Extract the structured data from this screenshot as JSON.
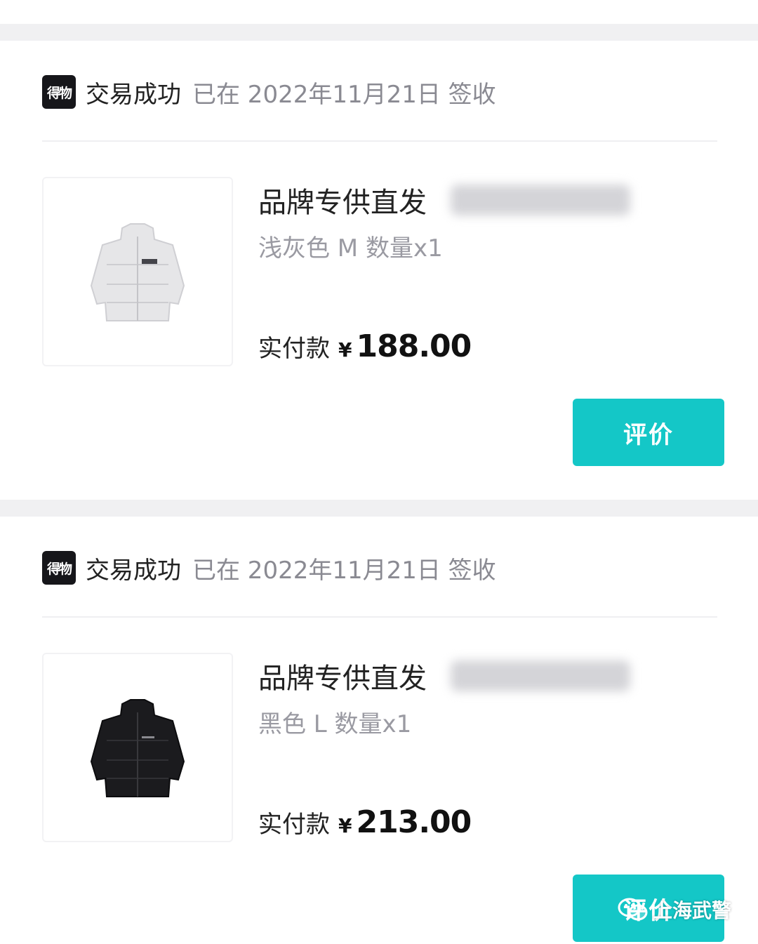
{
  "colors": {
    "accent": "#14c7c7",
    "page_background": "#f0f0f2",
    "muted_text": "#8a8a92"
  },
  "orders": [
    {
      "shop_logo_text": "得物",
      "status": "交易成功",
      "sign_info": "已在 2022年11月21日 签收",
      "product_title": "品牌专供直发",
      "spec": "浅灰色 M 数量x1",
      "pay_label": "实付款",
      "currency": "¥",
      "amount": "188.00",
      "review_label": "评价",
      "image_icon": "light-gray-puffer-jacket-icon"
    },
    {
      "shop_logo_text": "得物",
      "status": "交易成功",
      "sign_info": "已在 2022年11月21日 签收",
      "product_title": "品牌专供直发",
      "spec": "黑色 L 数量x1",
      "pay_label": "实付款",
      "currency": "¥",
      "amount": "213.00",
      "review_label": "评价",
      "image_icon": "black-puffer-jacket-icon"
    }
  ],
  "watermark": {
    "text": "上海武警",
    "icon": "wechat-icon"
  }
}
